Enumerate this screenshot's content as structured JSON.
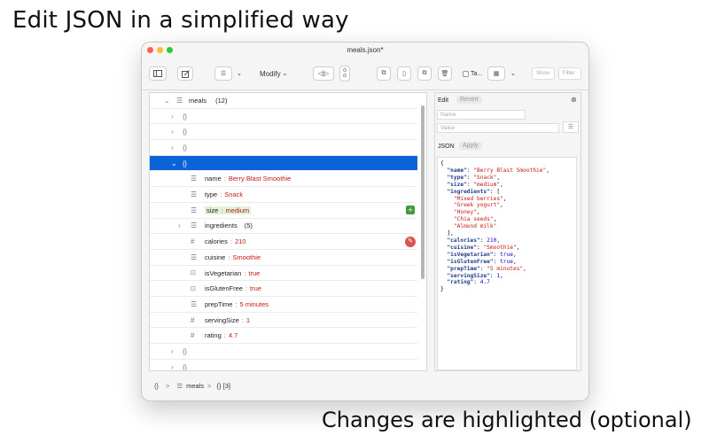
{
  "headline": "Edit JSON in a simplified way",
  "footline": "Changes are highlighted (optional)",
  "window": {
    "title": "meals.json*",
    "traffic_colors": [
      "#ff5f57",
      "#febc2e",
      "#28c840"
    ]
  },
  "toolbar": {
    "modify_label": "Modify",
    "ta_label": "Ta...",
    "show_placeholder": "Show",
    "filter_placeholder": "Filter"
  },
  "tree": {
    "root": {
      "key": "meals",
      "count": "(12)"
    },
    "collapsed_obj": "{}",
    "expanded_obj": "{}",
    "fields": [
      {
        "key": "name",
        "value": "Berry Blast Smoothie",
        "icon": "text-icon"
      },
      {
        "key": "type",
        "value": "Snack",
        "icon": "text-icon"
      },
      {
        "key": "size",
        "value": "medium",
        "icon": "text-icon",
        "highlight": true
      },
      {
        "key": "ingredients",
        "value": "(5)",
        "icon": "list-icon"
      },
      {
        "key": "calories",
        "value": "210",
        "icon": "number-icon"
      },
      {
        "key": "cuisine",
        "value": "Smoothie",
        "icon": "text-icon"
      },
      {
        "key": "isVegetarian",
        "value": "true",
        "icon": "bool-icon"
      },
      {
        "key": "isGlutenFree",
        "value": "true",
        "icon": "bool-icon"
      },
      {
        "key": "prepTime",
        "value": "5 minutes",
        "icon": "text-icon"
      },
      {
        "key": "servingSize",
        "value": "1",
        "icon": "number-icon"
      },
      {
        "key": "rating",
        "value": "4.7",
        "icon": "number-icon"
      }
    ],
    "separator": ":"
  },
  "editor": {
    "edit_label": "Edit",
    "revert_label": "Revert",
    "name_placeholder": "Name",
    "value_placeholder": "Value",
    "json_label": "JSON",
    "apply_label": "Apply",
    "json_lines": [
      "{",
      "  \"name\": \"Berry Blast Smoothie\",",
      "  \"type\": \"Snack\",",
      "  \"size\": \"medium\",",
      "  \"ingredients\": [",
      "    \"Mixed berries\",",
      "    \"Greek yogurt\",",
      "    \"Honey\",",
      "    \"Chia seeds\",",
      "    \"Almond milk\"",
      "  ],",
      "  \"calories\": 210,",
      "  \"cuisine\": \"Smoothie\",",
      "  \"isVegetarian\": true,",
      "  \"isGlutenFree\": true,",
      "  \"prepTime\": \"5 minutes\",",
      "  \"servingSize\": 1,",
      "  \"rating\": 4.7",
      "}"
    ]
  },
  "breadcrumb": {
    "root": "{}",
    "arrow": ">",
    "meals": "meals",
    "item": "{} [3]"
  }
}
